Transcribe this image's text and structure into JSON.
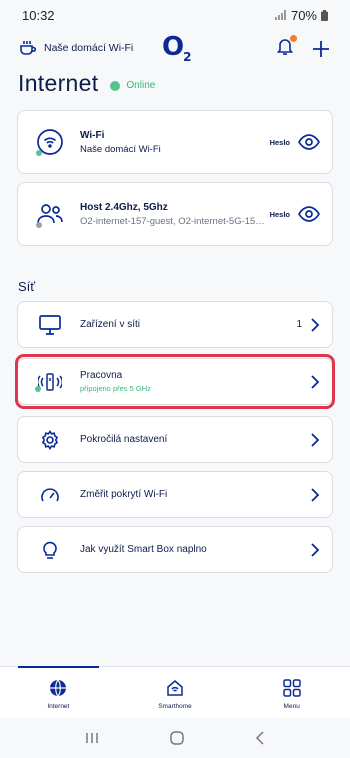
{
  "status": {
    "time": "10:32",
    "battery": "70%"
  },
  "header": {
    "network_name": "Naše domácí Wi-Fi",
    "logo": "O",
    "logo_sub": "2"
  },
  "page": {
    "title": "Internet",
    "status": "Online"
  },
  "wifi_cards": [
    {
      "title": "Wi-Fi",
      "subtitle": "Naše domácí Wi-Fi",
      "action": "Heslo",
      "icon": "wifi-icon"
    },
    {
      "title": "Host 2.4Ghz, 5Ghz",
      "subtitle": "O2-internet-157-guest, O2-internet-5G-157-...",
      "action": "Heslo",
      "icon": "guest-users-icon"
    }
  ],
  "section_title": "Síť",
  "items": [
    {
      "title": "Zařízení v síti",
      "count": "1",
      "icon": "monitor-icon"
    },
    {
      "title": "Pracovna",
      "subtitle": "připojeno přes 5 GHz",
      "icon": "extender-icon"
    },
    {
      "title": "Pokročilá nastavení",
      "icon": "gear-icon"
    },
    {
      "title": "Změřit pokrytí Wi-Fi",
      "icon": "speedometer-icon"
    },
    {
      "title": "Jak využít Smart Box naplno",
      "icon": "lightbulb-icon"
    }
  ],
  "tabs": [
    {
      "label": "Internet",
      "icon": "globe-icon",
      "active": true
    },
    {
      "label": "Smarthome",
      "icon": "smarthome-icon",
      "active": false
    },
    {
      "label": "Menu",
      "icon": "menu-grid-icon",
      "active": false
    }
  ],
  "colors": {
    "brand": "#0a2a96",
    "online": "#55c48e",
    "highlight": "#e0364d",
    "badge": "#f07d2e"
  }
}
